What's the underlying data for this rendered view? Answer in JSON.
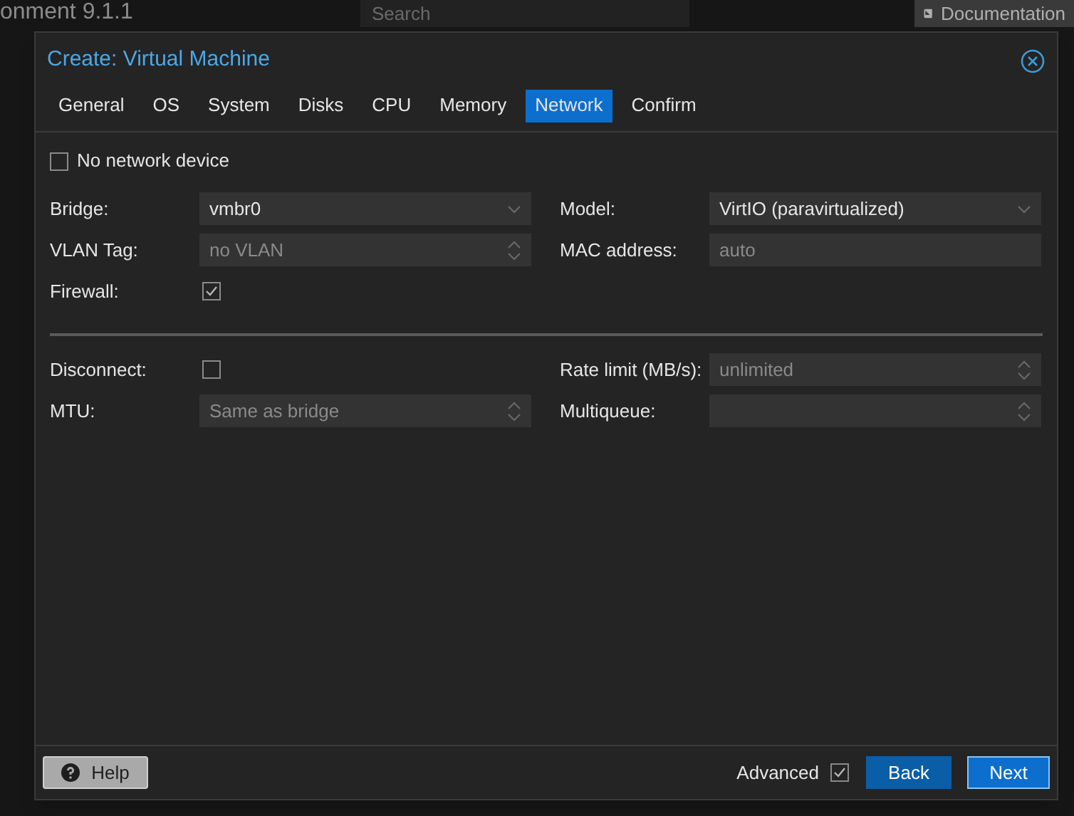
{
  "background": {
    "app_title": "onment 9.1.1",
    "search": {
      "placeholder": "Search"
    },
    "documentation_button": "Documentation"
  },
  "dialog": {
    "title": "Create: Virtual Machine",
    "tabs": [
      {
        "label": "General",
        "selected": false
      },
      {
        "label": "OS",
        "selected": false
      },
      {
        "label": "System",
        "selected": false
      },
      {
        "label": "Disks",
        "selected": false
      },
      {
        "label": "CPU",
        "selected": false
      },
      {
        "label": "Memory",
        "selected": false
      },
      {
        "label": "Network",
        "selected": true
      },
      {
        "label": "Confirm",
        "selected": false
      }
    ],
    "no_network_device": {
      "label": "No network device",
      "checked": false
    },
    "sections": [
      {
        "left": [
          {
            "kind": "combo",
            "label": "Bridge:",
            "value": "vmbr0"
          },
          {
            "kind": "spinner",
            "label": "VLAN Tag:",
            "placeholder": "no VLAN"
          },
          {
            "kind": "checkbox",
            "label": "Firewall:",
            "checked": true
          }
        ],
        "right": [
          {
            "kind": "combo",
            "label": "Model:",
            "value": "VirtIO (paravirtualized)"
          },
          {
            "kind": "text",
            "label": "MAC address:",
            "placeholder": "auto"
          }
        ]
      },
      {
        "left": [
          {
            "kind": "checkbox",
            "label": "Disconnect:",
            "checked": false
          },
          {
            "kind": "spinner",
            "label": "MTU:",
            "placeholder": "Same as bridge"
          }
        ],
        "right": [
          {
            "kind": "spinner",
            "label": "Rate limit (MB/s):",
            "placeholder": "unlimited"
          },
          {
            "kind": "spinner",
            "label": "Multiqueue:"
          }
        ]
      }
    ],
    "footer": {
      "help": "Help",
      "advanced": {
        "label": "Advanced",
        "checked": true
      },
      "back": "Back",
      "next": "Next"
    }
  }
}
